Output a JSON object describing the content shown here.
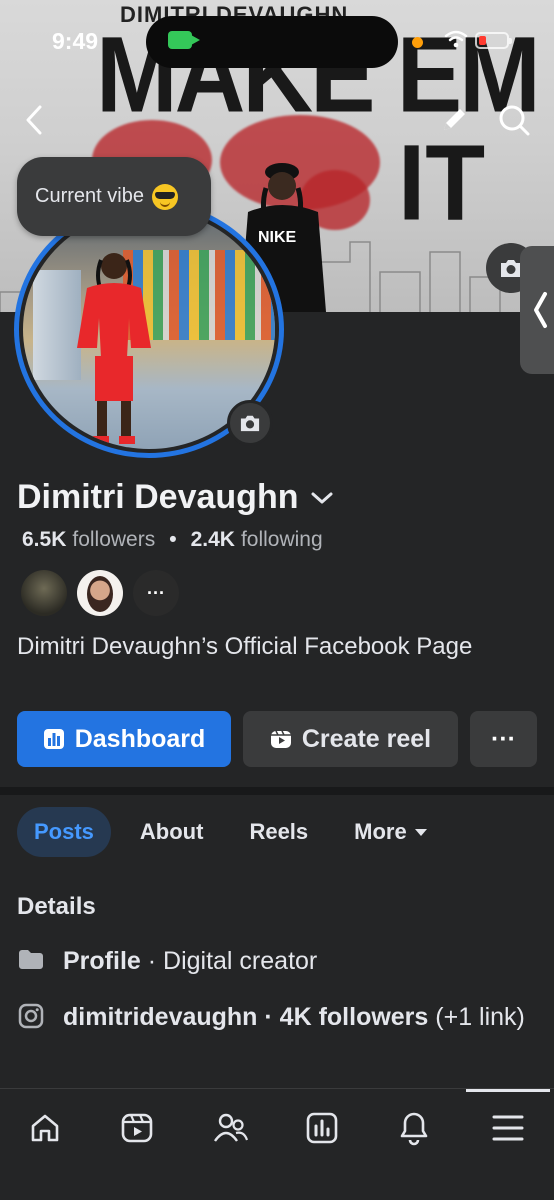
{
  "status_bar": {
    "time": "9:49"
  },
  "cover": {
    "title_small": "DIMITRI DEVAUGHN",
    "title_big_1": "MAKE EM",
    "title_big_2": "IT"
  },
  "vibe": {
    "text": "Current vibe"
  },
  "profile": {
    "name": "Dimitri Devaughn",
    "followers_count": "6.5K",
    "followers_label": "followers",
    "following_count": "2.4K",
    "following_label": "following",
    "bio": "Dimitri Devaughn’s Official Facebook Page"
  },
  "actions": {
    "dashboard": "Dashboard",
    "create_reel": "Create reel",
    "more": "···"
  },
  "tabs": [
    {
      "label": "Posts",
      "active": true
    },
    {
      "label": "About"
    },
    {
      "label": "Reels"
    },
    {
      "label": "More"
    }
  ],
  "details": {
    "title": "Details",
    "profile_label": "Profile",
    "profile_value": " · Digital creator",
    "instagram_text": "dimitridevaughn · 4K followers",
    "instagram_link": " (+1 link)"
  },
  "friends_more": "···",
  "bottom_nav": [
    "home-icon",
    "video-icon",
    "friends-icon",
    "dashboard-icon",
    "bell-icon",
    "menu-icon"
  ],
  "colors": {
    "accent": "#2374e1",
    "background": "#242526",
    "tab_active_bg": "#263951",
    "tab_active_text": "#4599ff"
  }
}
